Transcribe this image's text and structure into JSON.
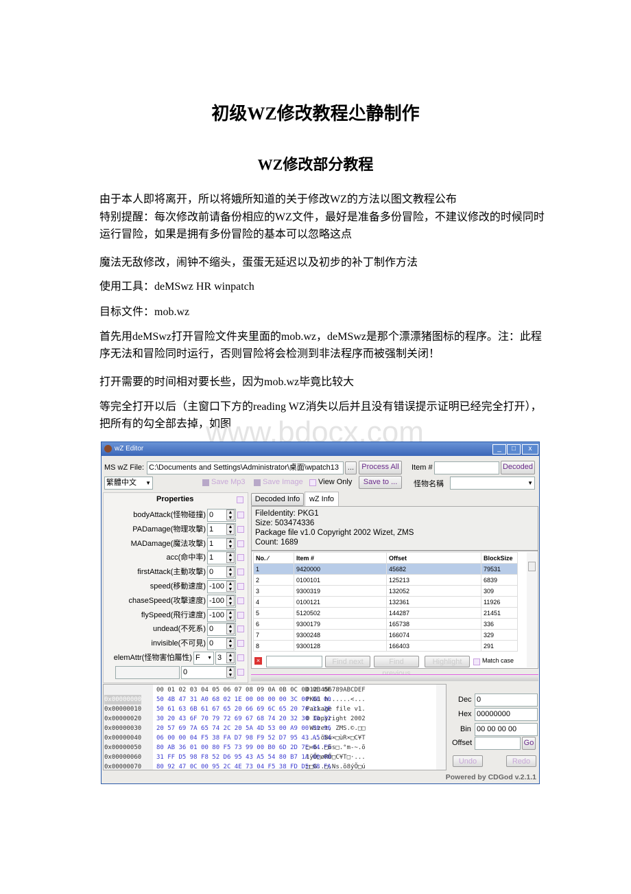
{
  "doc": {
    "title": "初级WZ修改教程尐静制作",
    "subtitle": "WZ修改部分教程",
    "paragraphs": [
      "由于本人即将离开，所以将娥所知道的关于修改WZ的方法以图文教程公布",
      "特别提醒：每次修改前请备份相应的WZ文件，最好是准备多份冒险，不建议修改的时候同时运行冒险，如果是拥有多份冒险的基本可以忽略这点",
      "魔法无敌修改，闹钟不缩头，蛋蛋无延迟以及初步的补丁制作方法",
      "使用工具：deMSwz HR winpatch",
      "目标文件：mob.wz",
      "首先用deMSwz打开冒险文件夹里面的mob.wz，deMSwz是那个漂漂猪图标的程序。注：此程序无法和冒险同时运行，否则冒险将会检测到非法程序而被强制关闭！",
      "打开需要的时间相对要长些，因为mob.wz毕竟比较大",
      "等完全打开以后（主窗口下方的reading WZ消失以后并且没有错误提示证明已经完全打开），把所有的勾全部去掉，如图"
    ],
    "watermark": "www.bdocx.com"
  },
  "app": {
    "title": "wZ Editor",
    "file_label": "MS wZ File:",
    "file_path": "C:\\Documents and Settings\\Administrator\\桌面\\wpatch13",
    "browse": "...",
    "process_all": "Process All",
    "item_label": "Item #",
    "item_value": "",
    "decoded": "Decoded",
    "language": "繁體中文",
    "save_mp3": "Save Mp3",
    "save_image": "Save Image",
    "view_only": "View Only",
    "save_to": "Save to ...",
    "monster_name_label": "怪物名稱",
    "properties_header": "Properties",
    "properties": [
      {
        "label": "bodyAttack(怪物碰撞)",
        "value": "0"
      },
      {
        "label": "PADamage(物理攻擊)",
        "value": "1"
      },
      {
        "label": "MADamage(魔法攻擊)",
        "value": "1"
      },
      {
        "label": "acc(命中率)",
        "value": "1"
      },
      {
        "label": "firstAttack(主動攻擊)",
        "value": "0"
      },
      {
        "label": "speed(移動速度)",
        "value": "-100"
      },
      {
        "label": "chaseSpeed(攻擊速度)",
        "value": "-100"
      },
      {
        "label": "flySpeed(飛行速度)",
        "value": "-100"
      },
      {
        "label": "undead(不死系)",
        "value": "0"
      },
      {
        "label": "invisible(不可見)",
        "value": "0"
      }
    ],
    "elem_attr": {
      "label": "elemAttr(怪物害怕屬性)",
      "select": "F",
      "value": "3"
    },
    "extra_value": "0",
    "tabs": [
      "Decoded Info",
      "wZ Info"
    ],
    "active_tab": "wZ Info",
    "info": [
      "FileIdentity: PKG1",
      "Size: 503474336",
      "Package file v1.0 Copyright 2002 Wizet, ZMS",
      "Count: 1689"
    ],
    "table": {
      "headers": [
        "No. ∕",
        "Item #",
        "Offset",
        "BlockSize"
      ],
      "rows": [
        [
          "1",
          "9420000",
          "45682",
          "79531"
        ],
        [
          "2",
          "0100101",
          "125213",
          "6839"
        ],
        [
          "3",
          "9300319",
          "132052",
          "309"
        ],
        [
          "4",
          "0100121",
          "132361",
          "11926"
        ],
        [
          "5",
          "5120502",
          "144287",
          "21451"
        ],
        [
          "6",
          "9300179",
          "165738",
          "336"
        ],
        [
          "7",
          "9300248",
          "166074",
          "329"
        ],
        [
          "8",
          "9300128",
          "166403",
          "291"
        ]
      ]
    },
    "find_next": "Find next",
    "find_previous": "Find previous",
    "highlight": "Highlight",
    "match_case": "Match case",
    "hex": {
      "header": "00 01 02 03 04 05 06 07 08 09 0A 0B 0C 0D 0E 0F",
      "ascii_header": "0123456789ABCDEF",
      "rows": [
        {
          "addr": "0x00000000",
          "bytes": "50 4B 47 31 A0 68 02 1E 00 00 00 00 3C 00 00 00",
          "ascii": "PKG1 h......<..."
        },
        {
          "addr": "0x00000010",
          "bytes": "50 61 63 6B 61 67 65 20 66 69 6C 65 20 76 31 2E",
          "ascii": "Package file v1."
        },
        {
          "addr": "0x00000020",
          "bytes": "30 20 43 6F 70 79 72 69 67 68 74 20 32 30 30 32",
          "ascii": "0 Copyright 2002"
        },
        {
          "addr": "0x00000030",
          "bytes": "20 57 69 7A 65 74 2C 20 5A 4D 53 00 A9 00 80 96",
          "ascii": " Wizet, ZMS.©.□□"
        },
        {
          "addr": "0x00000040",
          "bytes": "06 00 00 04 F5 38 FA D7 98 F9 52 D7 95 43 A5 54",
          "ascii": "....õ8ú×□ùR×□C¥T"
        },
        {
          "addr": "0x00000050",
          "bytes": "80 AB 36 01 00 80 F5 73 99 00 B0 6D 2D 7E 04 F5",
          "ascii": "□«6..□õs□.°m-~.õ"
        },
        {
          "addr": "0x00000060",
          "bytes": "31 FF D5 98 F8 52 D6 95 43 A5 54 80 B7 1A 00 00",
          "ascii": "1ÿÕ□øRÖ□C¥T□·..."
        },
        {
          "addr": "0x00000070",
          "bytes": "80 92 47 0C 00 95 2C 4E 73 04 F5 38 FD D5 98 FA",
          "ascii": "□□G..□,Ns.õ8ýÕ□ú"
        }
      ]
    },
    "dec_label": "Dec",
    "dec_value": "0",
    "hex_label": "Hex",
    "hex_value": "00000000",
    "bin_label": "Bin",
    "bin_value": "00 00 00 00",
    "offset_label": "Offset",
    "offset_value": "",
    "go": "Go",
    "undo": "Undo",
    "redo": "Redo",
    "footer": "Powered by CDGod v.2.1.1",
    "colors": {
      "titlebar": "#3a66b8",
      "selected_row": "#b8cce8",
      "hex_bytes": "#3a3ad0"
    }
  }
}
